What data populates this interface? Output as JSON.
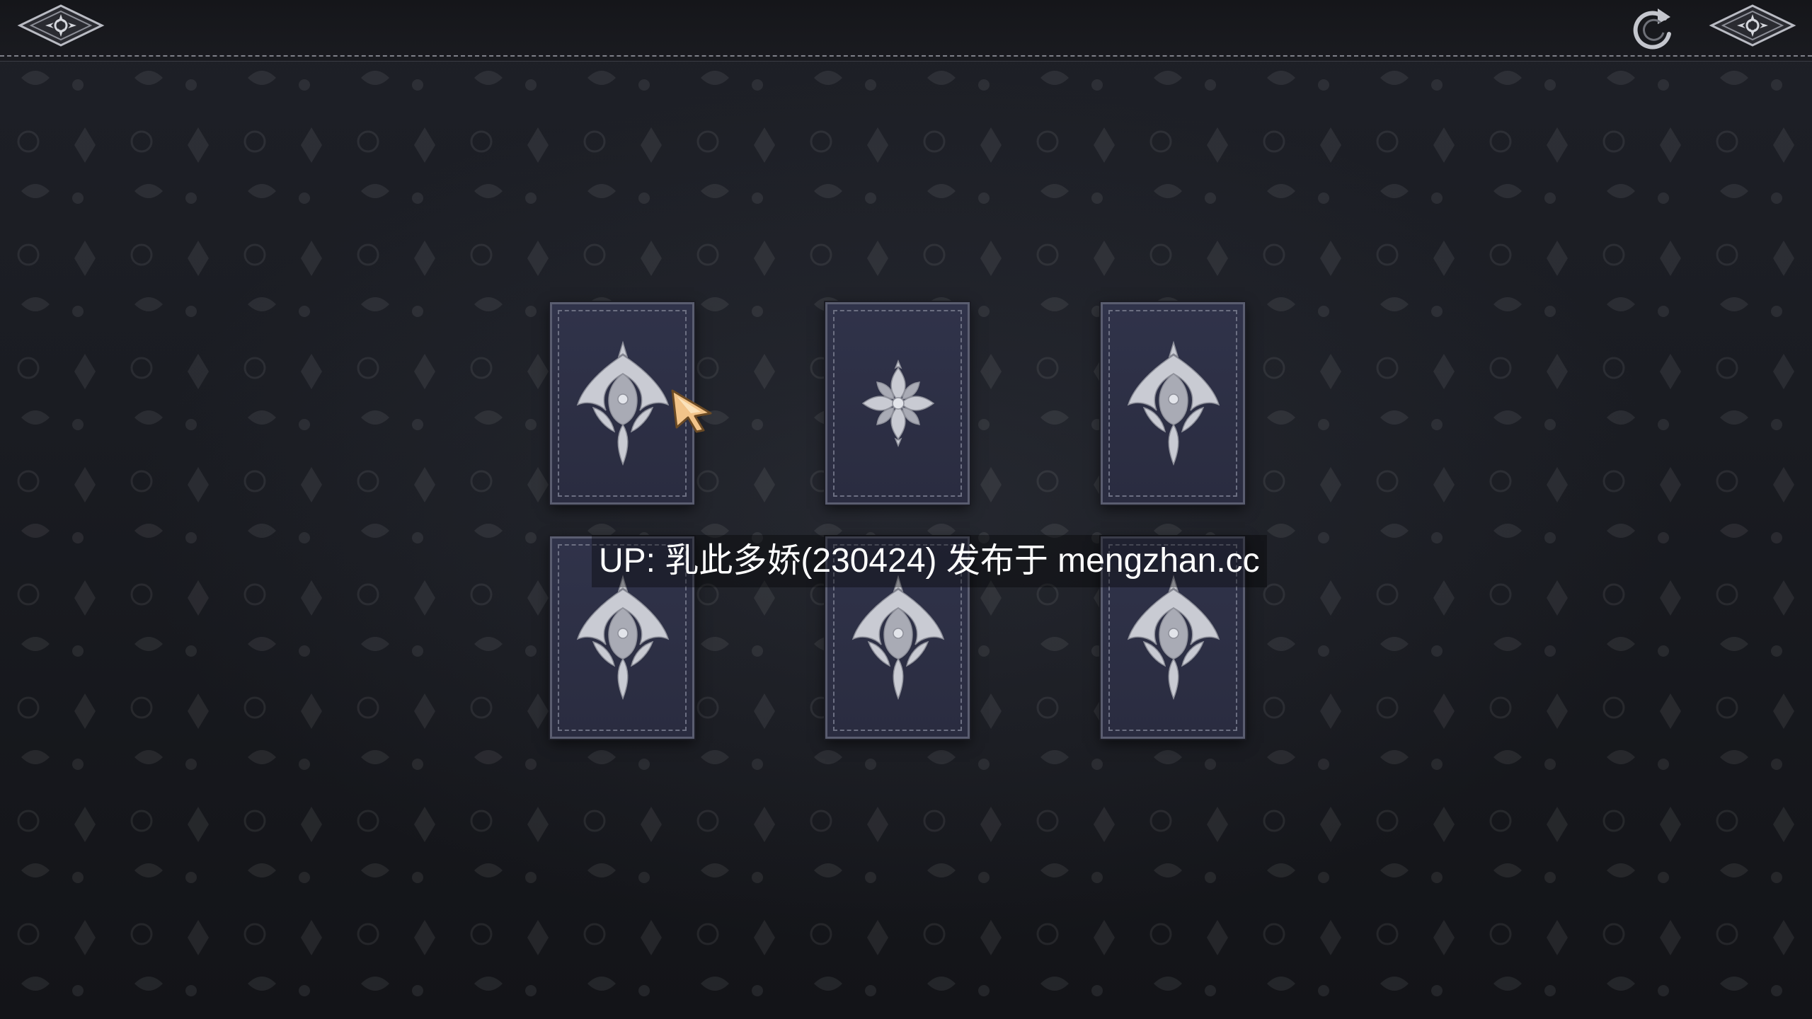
{
  "top_bar": {
    "left_emblem_icon": "diamond-ornament-icon",
    "right_emblem_icon": "diamond-ornament-icon",
    "refresh_icon": "refresh-icon"
  },
  "cards": [
    {
      "id": 1,
      "face": "down",
      "ornament_icon": "floral-diamond-ornament-icon"
    },
    {
      "id": 2,
      "face": "down",
      "ornament_icon": "floral-cross-ornament-icon"
    },
    {
      "id": 3,
      "face": "down",
      "ornament_icon": "floral-diamond-ornament-icon"
    },
    {
      "id": 4,
      "face": "down",
      "ornament_icon": "floral-diamond-ornament-icon"
    },
    {
      "id": 5,
      "face": "down",
      "ornament_icon": "floral-diamond-ornament-icon"
    },
    {
      "id": 6,
      "face": "down",
      "ornament_icon": "floral-diamond-ornament-icon"
    }
  ],
  "caption": {
    "text": "UP: 乳此多娇(230424) 发布于 mengzhan.cc"
  },
  "colors": {
    "background": "#1a1c22",
    "card_face": "#2e3146",
    "ornament": "#c8cad2",
    "cursor": "#f0c080"
  }
}
